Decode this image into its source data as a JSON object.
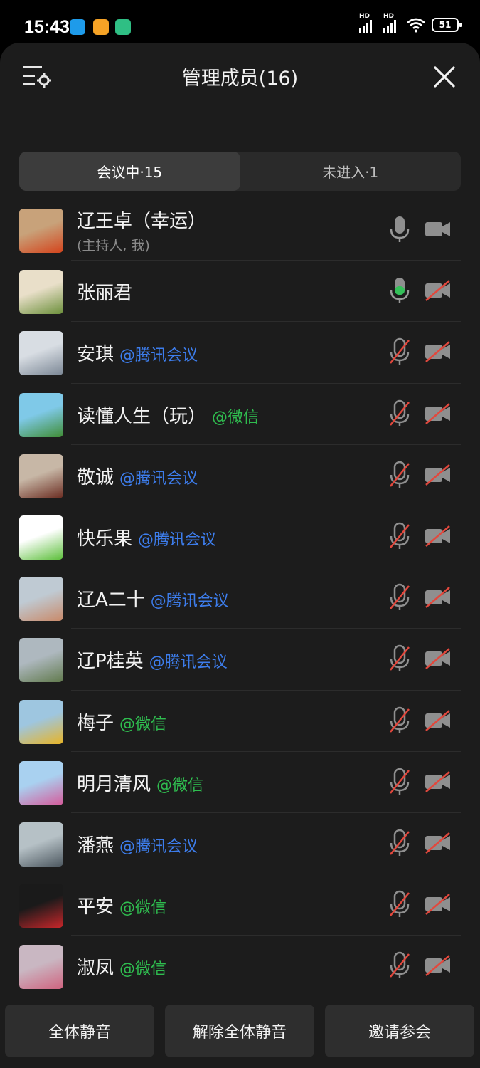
{
  "status_bar": {
    "time": "15:43",
    "hd1": "HD",
    "hd2": "HD",
    "battery": "51"
  },
  "header": {
    "title": "管理成员(16)"
  },
  "tabs": [
    {
      "label": "会议中·15"
    },
    {
      "label": "未进入·1"
    }
  ],
  "members": [
    {
      "name": "辽王卓（幸运）",
      "sub": "(主持人, 我)",
      "source": "",
      "mic": "idle",
      "cam": "off-gray"
    },
    {
      "name": "张丽君",
      "sub": "",
      "source": "",
      "mic": "active",
      "cam": "off"
    },
    {
      "name": "安琪",
      "source": "@腾讯会议",
      "source_type": "tx",
      "mic": "muted",
      "cam": "off"
    },
    {
      "name": "读懂人生（玩）",
      "source": "@微信",
      "source_type": "wx",
      "mic": "muted",
      "cam": "off"
    },
    {
      "name": "敬诚",
      "source": "@腾讯会议",
      "source_type": "tx",
      "mic": "muted",
      "cam": "off"
    },
    {
      "name": "快乐果",
      "source": "@腾讯会议",
      "source_type": "tx",
      "mic": "muted",
      "cam": "off"
    },
    {
      "name": "辽A二十",
      "source": "@腾讯会议",
      "source_type": "tx",
      "mic": "muted",
      "cam": "off"
    },
    {
      "name": "辽P桂英",
      "source": "@腾讯会议",
      "source_type": "tx",
      "mic": "muted",
      "cam": "off"
    },
    {
      "name": "梅子",
      "source": "@微信",
      "source_type": "wx",
      "mic": "muted",
      "cam": "off"
    },
    {
      "name": "明月清风",
      "source": "@微信",
      "source_type": "wx",
      "mic": "muted",
      "cam": "off"
    },
    {
      "name": "潘燕",
      "source": "@腾讯会议",
      "source_type": "tx",
      "mic": "muted",
      "cam": "off"
    },
    {
      "name": "平安",
      "source": "@微信",
      "source_type": "wx",
      "mic": "muted",
      "cam": "off"
    },
    {
      "name": "淑凤",
      "source": "@微信",
      "source_type": "wx",
      "mic": "muted",
      "cam": "off"
    }
  ],
  "bottom_buttons": {
    "mute_all": "全体静音",
    "unmute_all": "解除全体静音",
    "invite": "邀请参会"
  },
  "colors": {
    "tencent_blue": "#3d7dec",
    "wechat_green": "#2fbd4f",
    "muted_red": "#e2483d",
    "active_green": "#35c05a"
  }
}
